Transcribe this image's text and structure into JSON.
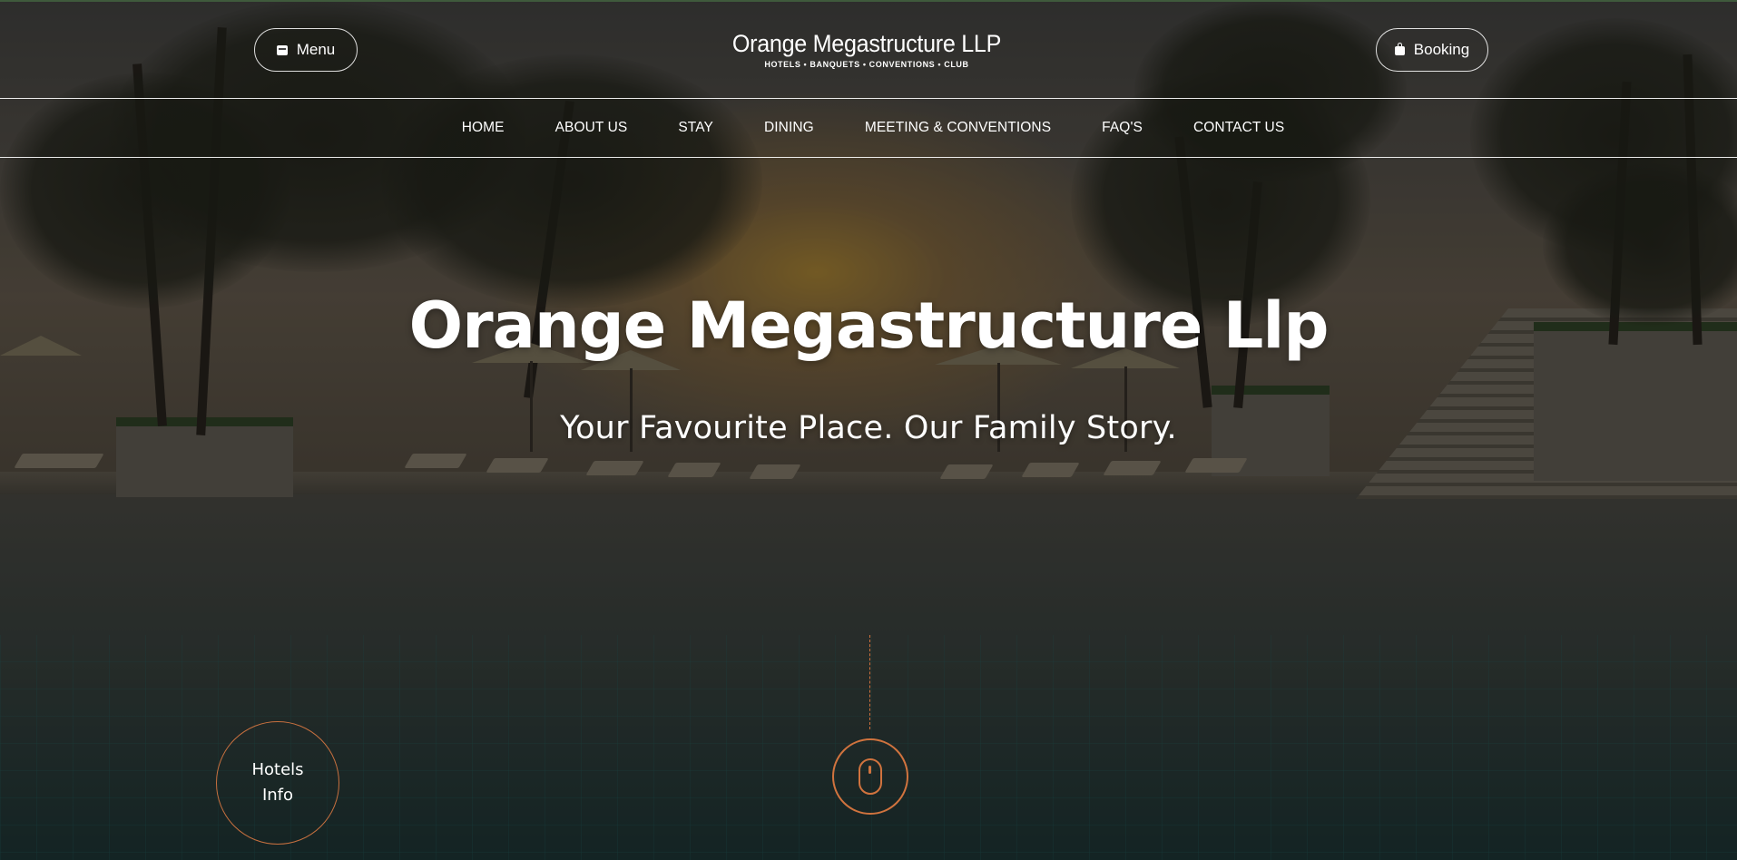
{
  "header": {
    "menu_label": "Menu",
    "menu_icon": "menu-card-icon",
    "booking_label": "Booking",
    "booking_icon": "bag-icon",
    "logo_title": "Orange Megastructure LLP",
    "logo_tagline": "HOTELS • BANQUETS • CONVENTIONS • CLUB"
  },
  "nav": {
    "items": [
      {
        "label": "HOME"
      },
      {
        "label": "ABOUT US"
      },
      {
        "label": "STAY"
      },
      {
        "label": "DINING"
      },
      {
        "label": "MEETING & CONVENTIONS"
      },
      {
        "label": "FAQ'S"
      },
      {
        "label": "CONTACT US"
      }
    ]
  },
  "hero": {
    "title": "Orange Megastructure Llp",
    "subtitle": "Your Favourite Place. Our Family Story."
  },
  "widgets": {
    "hotels_info_label": "Hotels Info",
    "scroll_icon": "mouse-icon"
  },
  "colors": {
    "accent": "#d0733e",
    "text": "#ffffff",
    "header_top_border": "#3f5a3c"
  }
}
